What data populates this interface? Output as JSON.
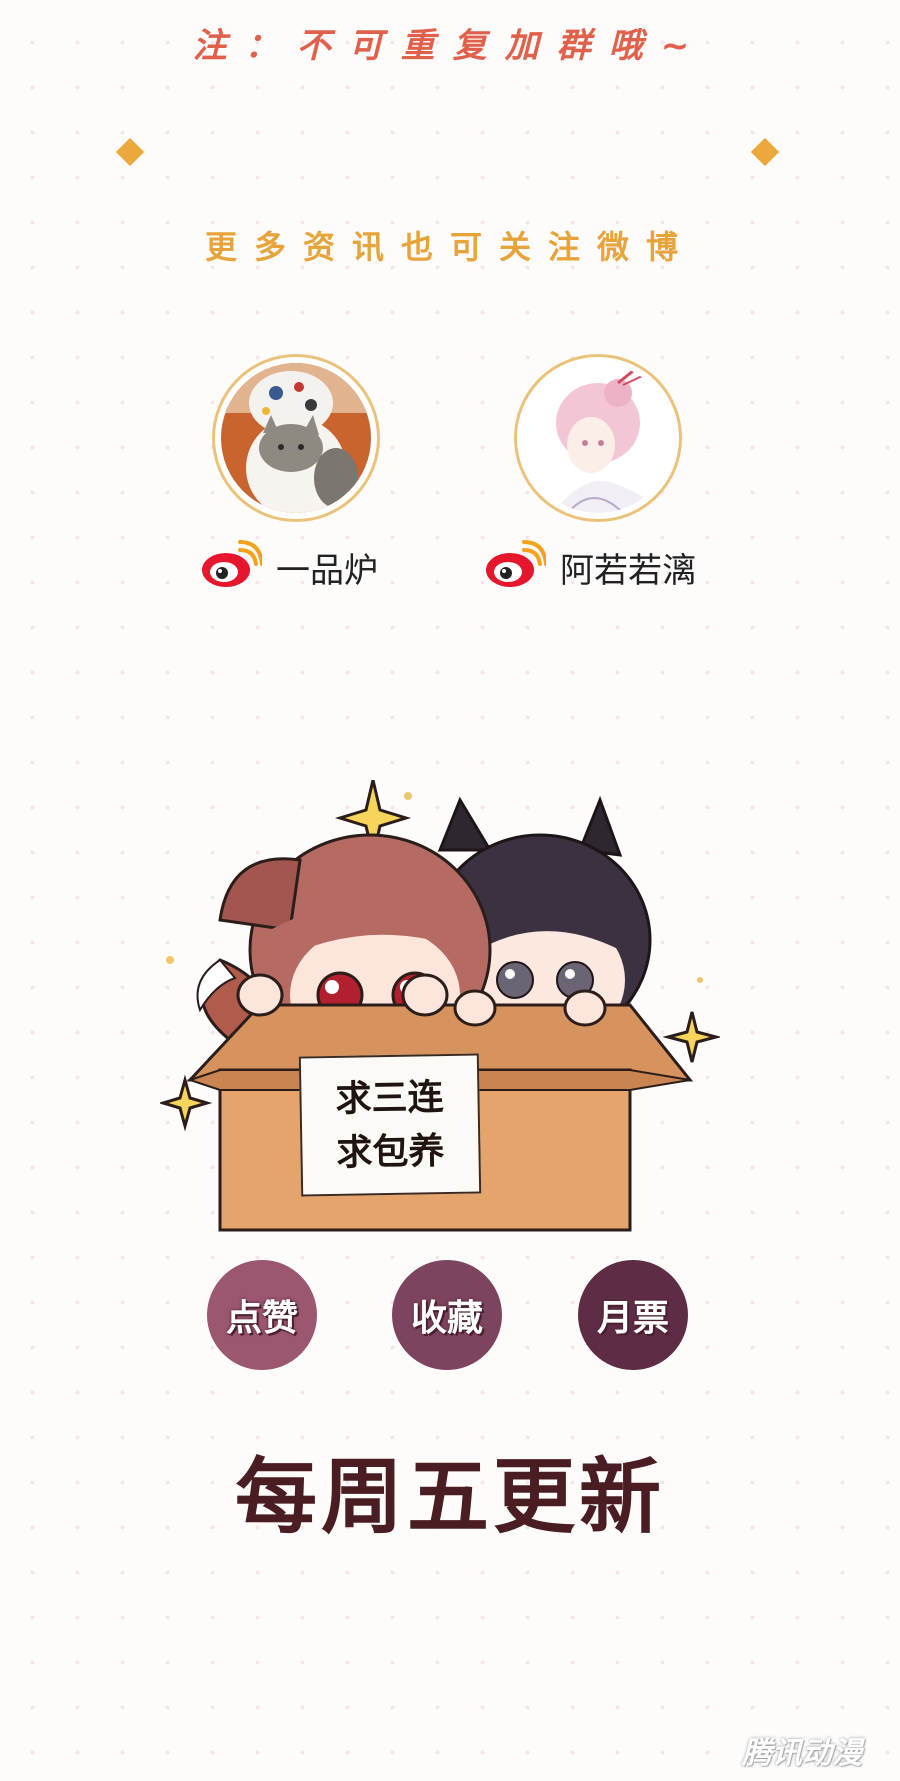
{
  "notice": "注：不可重复加群哦~",
  "follow_text": "更多资讯也可关注微博",
  "accounts": [
    {
      "name": "一品炉",
      "icon": "weibo-icon"
    },
    {
      "name": "阿若若漓",
      "icon": "weibo-icon"
    }
  ],
  "sign": {
    "line1": "求三连",
    "line2": "求包养"
  },
  "actions": [
    {
      "label": "点赞",
      "color": "#9b5670"
    },
    {
      "label": "收藏",
      "color": "#7d4460"
    },
    {
      "label": "月票",
      "color": "#5e2d45"
    }
  ],
  "update_text": "每周五更新",
  "watermark": "腾讯动漫"
}
